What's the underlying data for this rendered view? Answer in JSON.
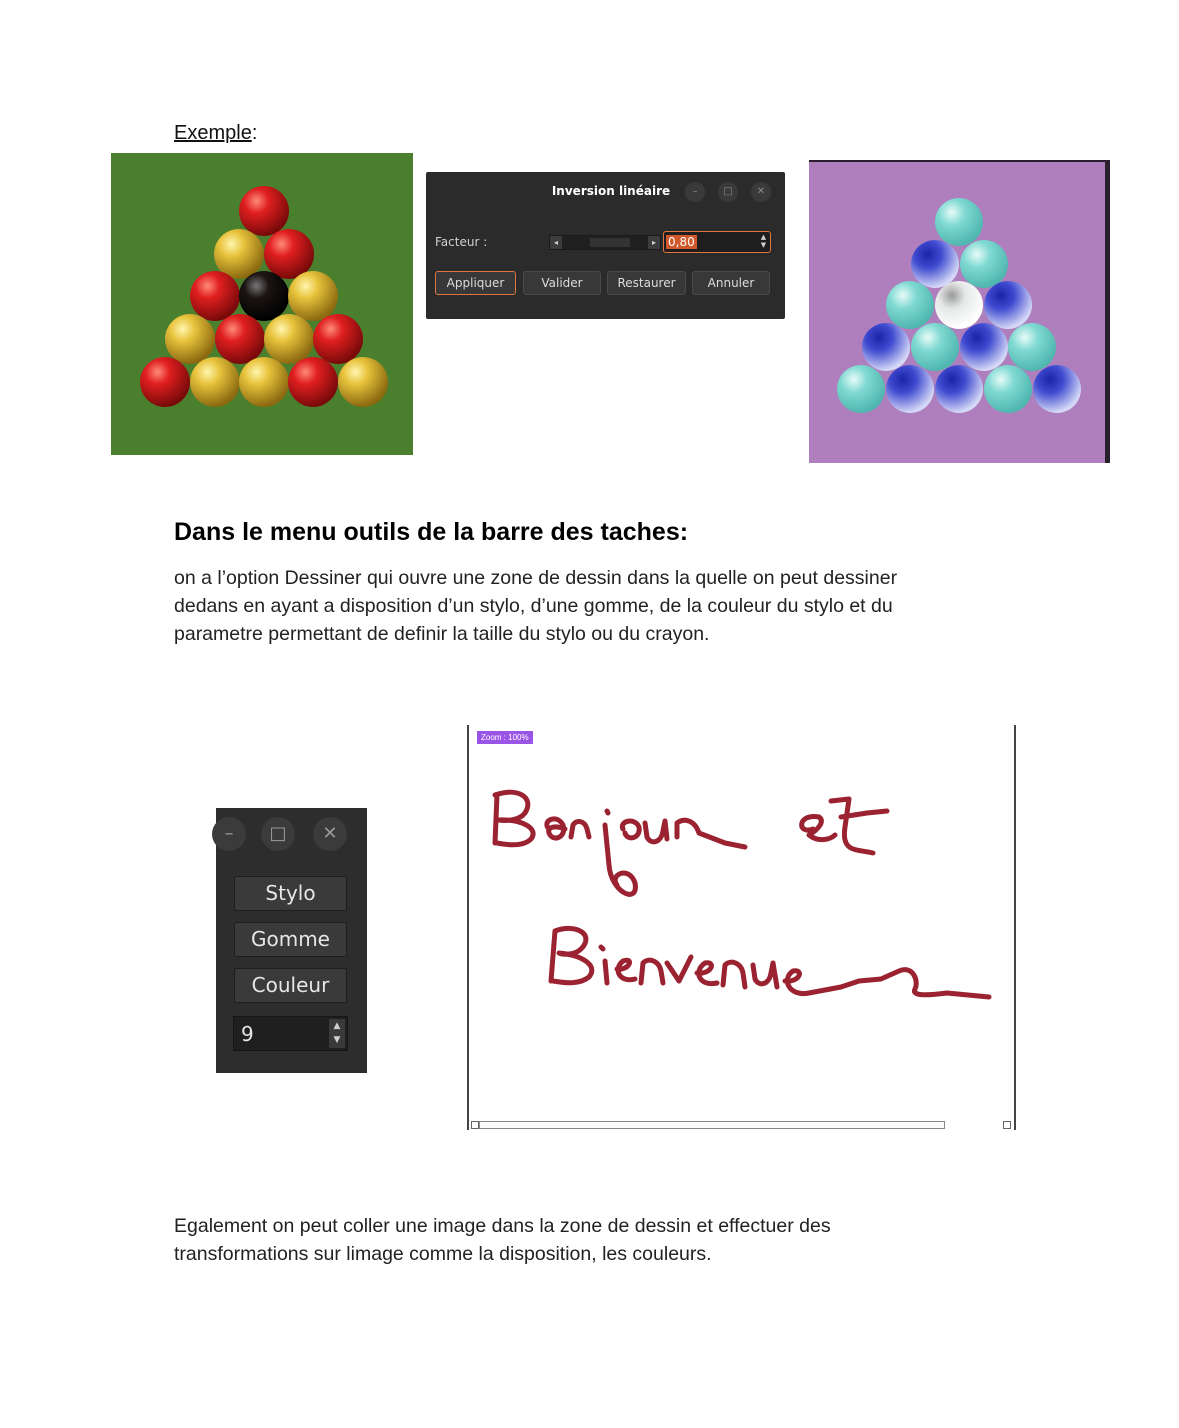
{
  "intro": {
    "label": "Exemple",
    "suffix": ":"
  },
  "images": {
    "original": {
      "description_icon": "billiard-balls-original",
      "background": "#4a7f2e",
      "ball_colors": [
        "#d81c1c",
        "#e6c13a",
        "#1a1a1a"
      ]
    },
    "inverted": {
      "description_icon": "billiard-balls-inverted",
      "background": "#ae7fbc",
      "ball_colors": [
        "#7ed8d2",
        "#3c45c8",
        "#e6e6e6"
      ]
    }
  },
  "dialog": {
    "title": "Inversion linéaire",
    "window_buttons": [
      "–",
      "□",
      "✕"
    ],
    "factor_label": "Facteur :",
    "factor_value": "0,80",
    "buttons": [
      "Appliquer",
      "Valider",
      "Restaurer",
      "Annuler"
    ],
    "accent": "#e0763d"
  },
  "section": {
    "heading": "Dans le menu outils de la barre des taches:",
    "paragraph_lines": [
      "on a l’option Dessiner qui ouvre une zone de dessin dans la quelle on peut dessiner",
      "dedans en ayant a disposition d’un stylo, d’une gomme, de la couleur du stylo et du",
      "parametre permettant de definir la taille du stylo ou du crayon."
    ]
  },
  "palette": {
    "window_buttons": [
      "–",
      "□",
      "✕"
    ],
    "tools": [
      "Stylo",
      "Gomme",
      "Couleur"
    ],
    "size_value": "9"
  },
  "canvas": {
    "zoom_label": "Zoom : 100%",
    "handwriting": [
      "Bonjour et",
      "Bienvenue"
    ],
    "ink_color": "#9b2230"
  },
  "footer": {
    "paragraph_lines": [
      "Egalement on peut coller une image dans la zone de dessin et effectuer des",
      "transformations sur limage comme la disposition, les couleurs."
    ]
  }
}
